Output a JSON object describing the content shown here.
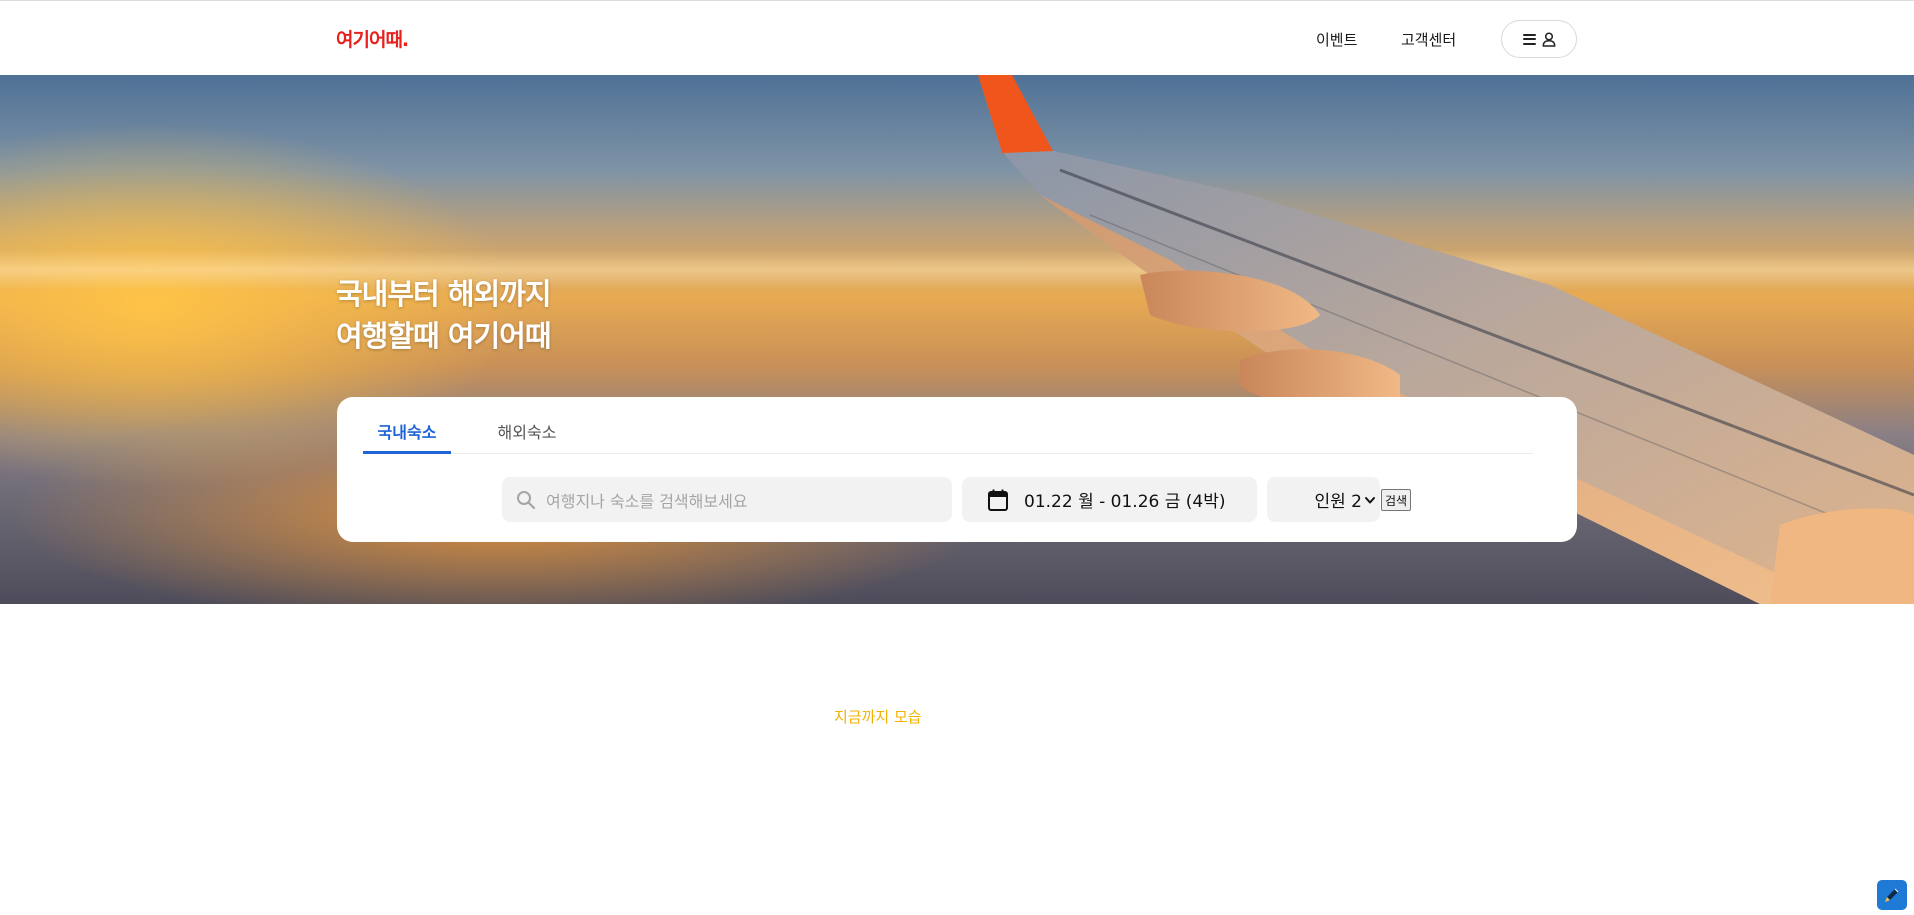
{
  "header": {
    "logo_text": "여기어때.",
    "nav": {
      "events": "이벤트",
      "support": "고객센터"
    },
    "menu_icons": [
      "hamburger-icon",
      "user-icon"
    ]
  },
  "hero": {
    "title_line1": "국내부터 해외까지",
    "title_line2": "여행할때 여기어때"
  },
  "search": {
    "tabs": [
      {
        "label": "국내숙소",
        "active": true
      },
      {
        "label": "해외숙소",
        "active": false
      }
    ],
    "placeholder": "여행지나 숙소를 검색해보세요",
    "date_range": "01.22 월 - 01.26 금 (4박)",
    "guests_label": "인원 2",
    "search_button": "검색"
  },
  "main": {
    "status_text": "지금까지 모습"
  },
  "colors": {
    "brand_red": "#e8211f",
    "tab_active_blue": "#1e63d8",
    "status_yellow": "#f3b200",
    "fab_blue": "#1f7ad6"
  }
}
